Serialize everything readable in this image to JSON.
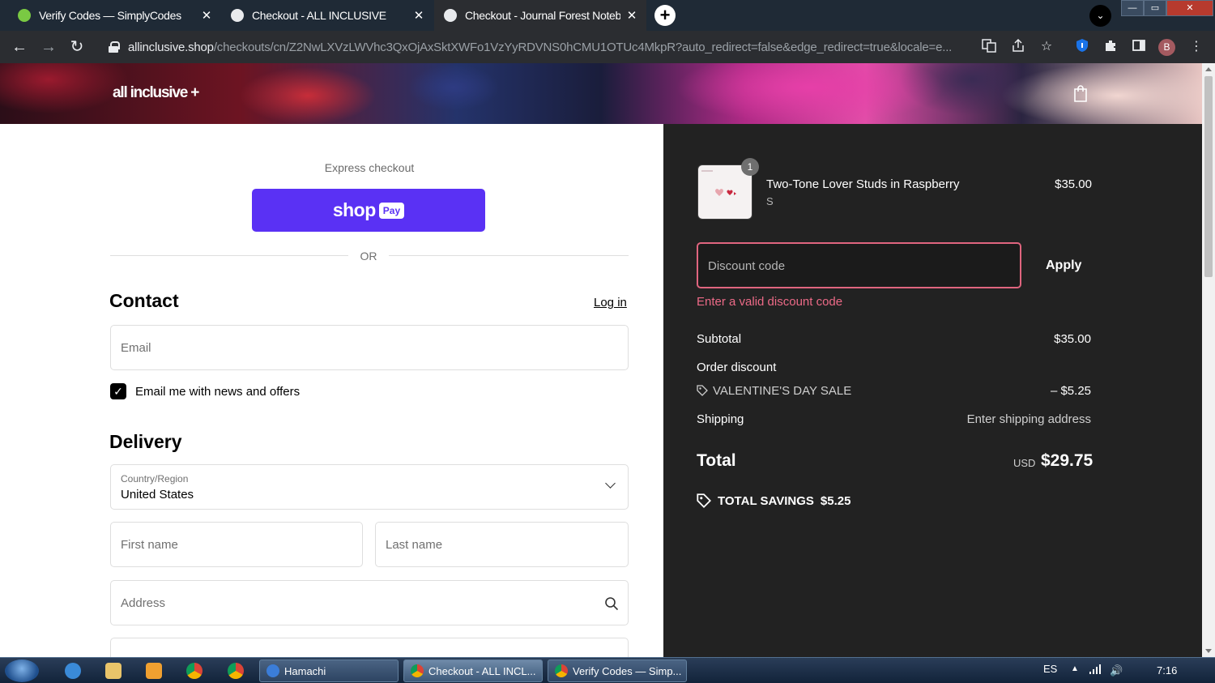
{
  "browser": {
    "tabs": [
      {
        "title": "Verify Codes — SimplyCodes",
        "close": "✕"
      },
      {
        "title": "Checkout - ALL INCLUSIVE",
        "close": "✕"
      },
      {
        "title": "Checkout - Journal Forest Notebo",
        "close": "✕"
      }
    ],
    "new_tab": "+",
    "tab_search": "⌄",
    "url_domain": "allinclusive.shop",
    "url_path": "/checkouts/cn/Z2NwLXVzLWVhc3QxOjAxSktXWFo1VzYyRDVNS0hCMU1OTUc4MkpR?auto_redirect=false&edge_redirect=true&locale=e...",
    "profile_initial": "B",
    "back": "←",
    "forward": "→",
    "reload": "↻",
    "menu": "⋮"
  },
  "header": {
    "brand": "all inclusive +"
  },
  "checkout": {
    "express_title": "Express checkout",
    "shoppay_word": "shop",
    "shoppay_badge": "Pay",
    "or": "OR",
    "contact_title": "Contact",
    "login": "Log in",
    "email_placeholder": "Email",
    "newsletter_checked": true,
    "newsletter_label": "Email me with news and offers",
    "delivery_title": "Delivery",
    "country_label": "Country/Region",
    "country_value": "United States",
    "first_name_placeholder": "First name",
    "last_name_placeholder": "Last name",
    "address_placeholder": "Address"
  },
  "summary": {
    "product": {
      "name": "Two-Tone Lover Studs in Raspberry",
      "variant": "S",
      "price": "$35.00",
      "quantity": "1"
    },
    "discount_placeholder": "Discount code",
    "apply": "Apply",
    "discount_error": "Enter a valid discount code",
    "subtotal_label": "Subtotal",
    "subtotal_value": "$35.00",
    "order_discount_label": "Order discount",
    "discount_name": "VALENTINE'S DAY SALE",
    "discount_value": "– $5.25",
    "shipping_label": "Shipping",
    "shipping_value": "Enter shipping address",
    "total_label": "Total",
    "total_currency": "USD",
    "total_value": "$29.75",
    "savings_label": "TOTAL SAVINGS",
    "savings_value": "$5.25"
  },
  "taskbar": {
    "items": [
      "Hamachi",
      "Checkout - ALL INCL...",
      "Verify Codes — Simp..."
    ],
    "lang": "ES",
    "time": "7:16"
  },
  "colors": {
    "shoppay": "#5a31f4",
    "summary_bg": "#222222",
    "error": "#ec6a87"
  }
}
